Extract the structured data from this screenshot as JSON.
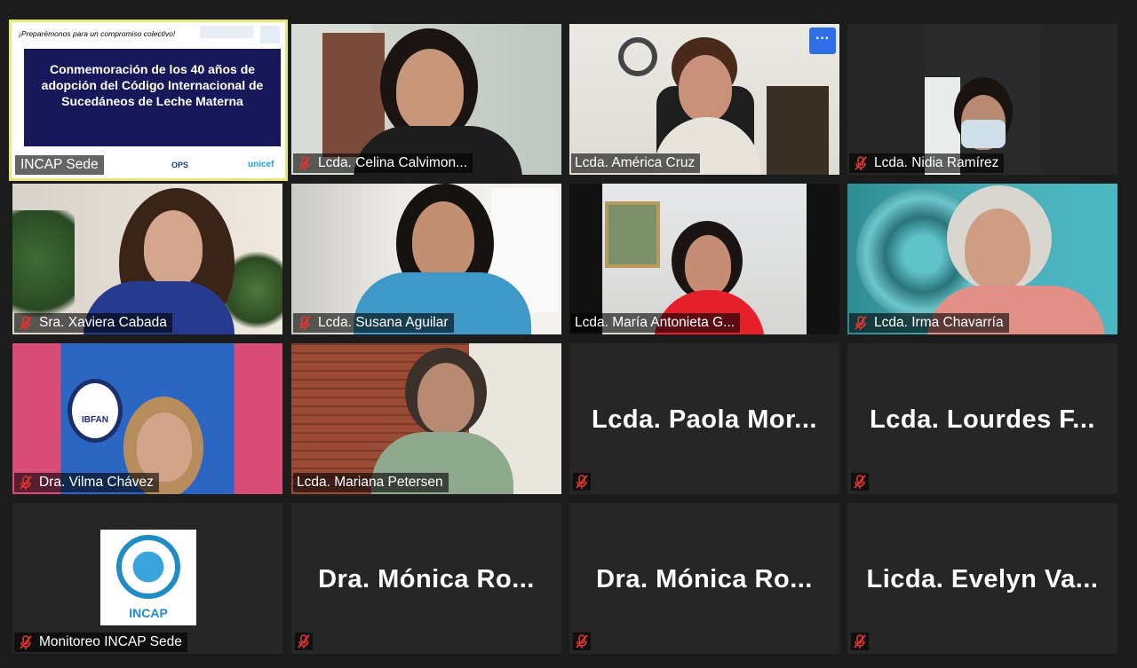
{
  "tiles": {
    "incap_sede": {
      "name": "INCAP Sede",
      "slide": {
        "tagline": "¡Preparémonos para un compromiso colectivo!",
        "title": "Conmemoración de los 40 años de adopción del Código Internacional de Sucedáneos de Leche Materna",
        "logos": [
          "OPS",
          "unicef"
        ]
      }
    },
    "celina": {
      "name": "Lcda. Celina Calvimon..."
    },
    "america": {
      "name": "Lcda. América Cruz",
      "more_label": "···"
    },
    "nidia": {
      "name": "Lcda. Nidia Ramírez"
    },
    "xaviera": {
      "name": "Sra. Xaviera Cabada"
    },
    "susana": {
      "name": "Lcda. Susana Aguilar"
    },
    "maria": {
      "name": "Lcda. María Antonieta G..."
    },
    "irma": {
      "name": "Lcda. Irma Chavarría"
    },
    "vilma": {
      "name": "Dra. Vilma Chávez",
      "poster_text": "IBFAN"
    },
    "mariana": {
      "name": "Lcda. Mariana Petersen"
    },
    "paola": {
      "name": "Lcda. Paola Mor..."
    },
    "lourdes": {
      "name": "Lcda. Lourdes F..."
    },
    "monitoreo": {
      "name": "Monitoreo INCAP Sede",
      "logo_text": "INCAP"
    },
    "monica1": {
      "name": "Dra. Mónica Ro..."
    },
    "monica2": {
      "name": "Dra. Mónica Ro..."
    },
    "evelyn": {
      "name": "Licda. Evelyn Va..."
    }
  },
  "colors": {
    "background": "#1c1c1c",
    "tile": "#262626",
    "active_speaker_border": "#e8e87a",
    "muted_icon": "#e0362f",
    "accent": "#2d6fe6"
  },
  "icons": {
    "muted": "mic-muted-icon",
    "more": "more-options-icon"
  }
}
